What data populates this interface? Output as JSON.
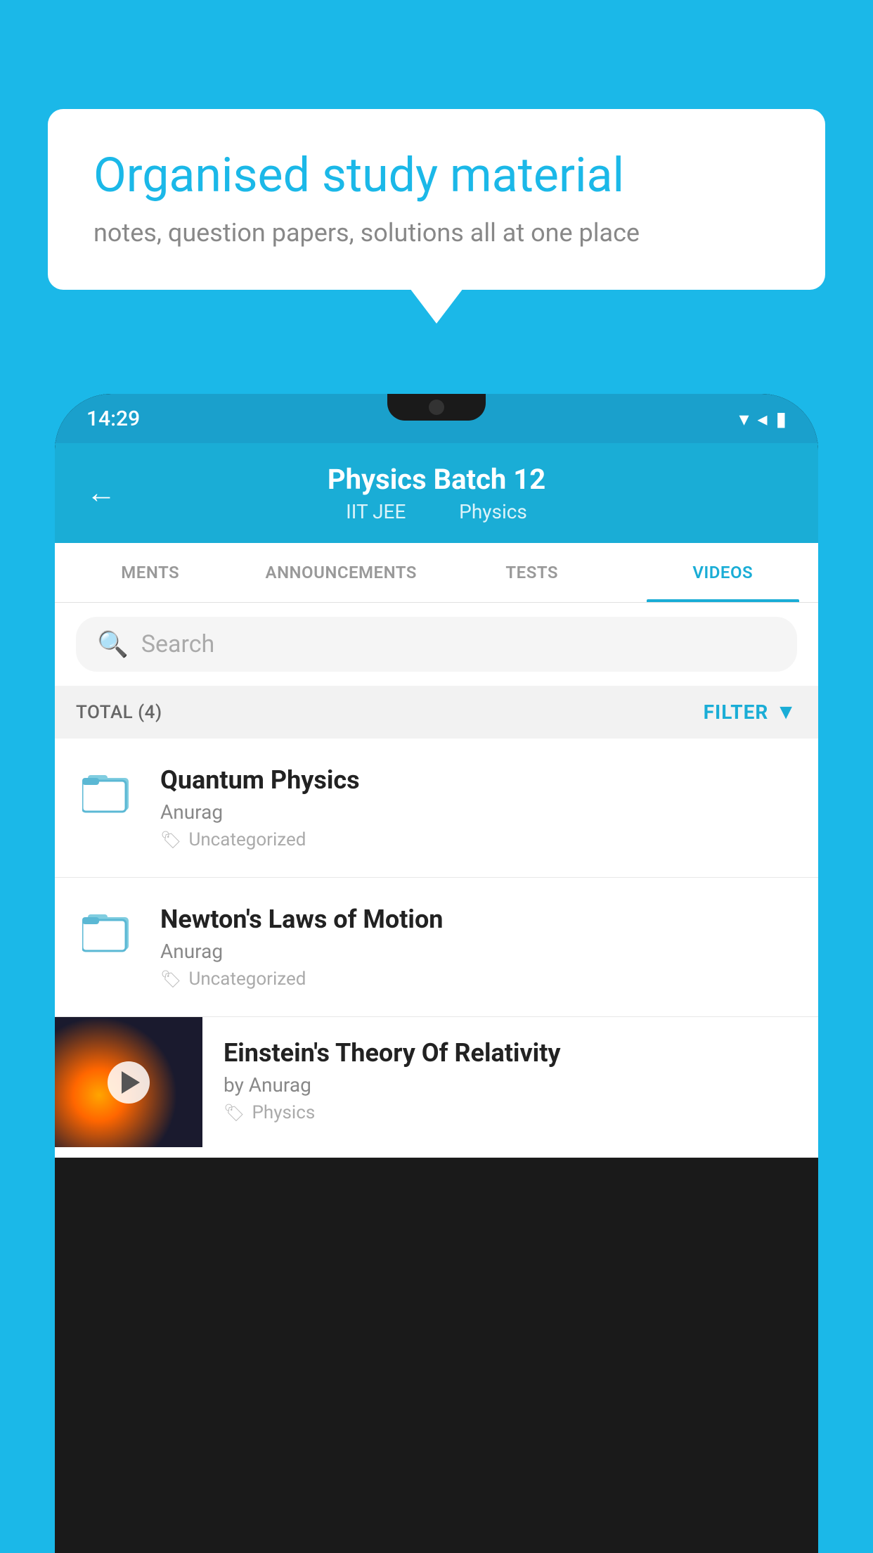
{
  "background_color": "#1BB8E8",
  "speech_bubble": {
    "title": "Organised study material",
    "subtitle": "notes, question papers, solutions all at one place"
  },
  "phone": {
    "status_bar": {
      "time": "14:29",
      "icons": "▼◀▮"
    },
    "header": {
      "back_label": "←",
      "title": "Physics Batch 12",
      "subtitle_part1": "IIT JEE",
      "subtitle_part2": "Physics"
    },
    "tabs": [
      {
        "label": "MENTS",
        "active": false
      },
      {
        "label": "ANNOUNCEMENTS",
        "active": false
      },
      {
        "label": "TESTS",
        "active": false
      },
      {
        "label": "VIDEOS",
        "active": true
      }
    ],
    "search": {
      "placeholder": "Search"
    },
    "filter": {
      "total_label": "TOTAL (4)",
      "filter_label": "FILTER"
    },
    "list_items": [
      {
        "title": "Quantum Physics",
        "author": "Anurag",
        "tag": "Uncategorized",
        "has_thumbnail": false
      },
      {
        "title": "Newton's Laws of Motion",
        "author": "Anurag",
        "tag": "Uncategorized",
        "has_thumbnail": false
      },
      {
        "title": "Einstein's Theory Of Relativity",
        "author": "by Anurag",
        "tag": "Physics",
        "has_thumbnail": true
      }
    ]
  }
}
